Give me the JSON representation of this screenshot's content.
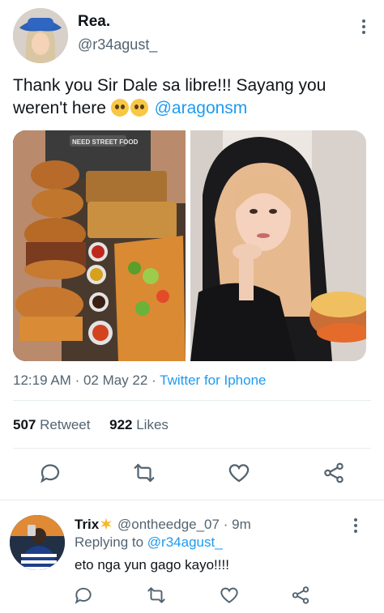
{
  "tweet": {
    "author_name": "Rea.",
    "author_handle": "@r34agust_",
    "text": "Thank you Sir Dale sa libre!!! Sayang you weren't here",
    "mention": "@aragonsm",
    "media_caption_1": "NEED STREET FOOD",
    "time": "12:19 AM",
    "date": "02 May 22",
    "source": "Twitter for Iphone",
    "retweets_count": "507",
    "retweets_label": "Retweet",
    "likes_count": "922",
    "likes_label": "Likes"
  },
  "reply": {
    "author_name": "Trix",
    "author_handle": "@ontheedge_07",
    "age": "9m",
    "replying_to_label": "Replying to",
    "replying_to_handle": "@r34agust_",
    "text": "eto nga yun gago kayo!!!!"
  },
  "icons": [
    "more-vertical-icon",
    "reply-icon",
    "retweet-icon",
    "like-icon",
    "share-icon",
    "sparkle-icon",
    "pleading-face-emoji"
  ],
  "colors": {
    "accent": "#1d9bf0",
    "secondary_text": "#536471",
    "primary_text": "#0f1419",
    "divider": "#e6ecf0"
  }
}
